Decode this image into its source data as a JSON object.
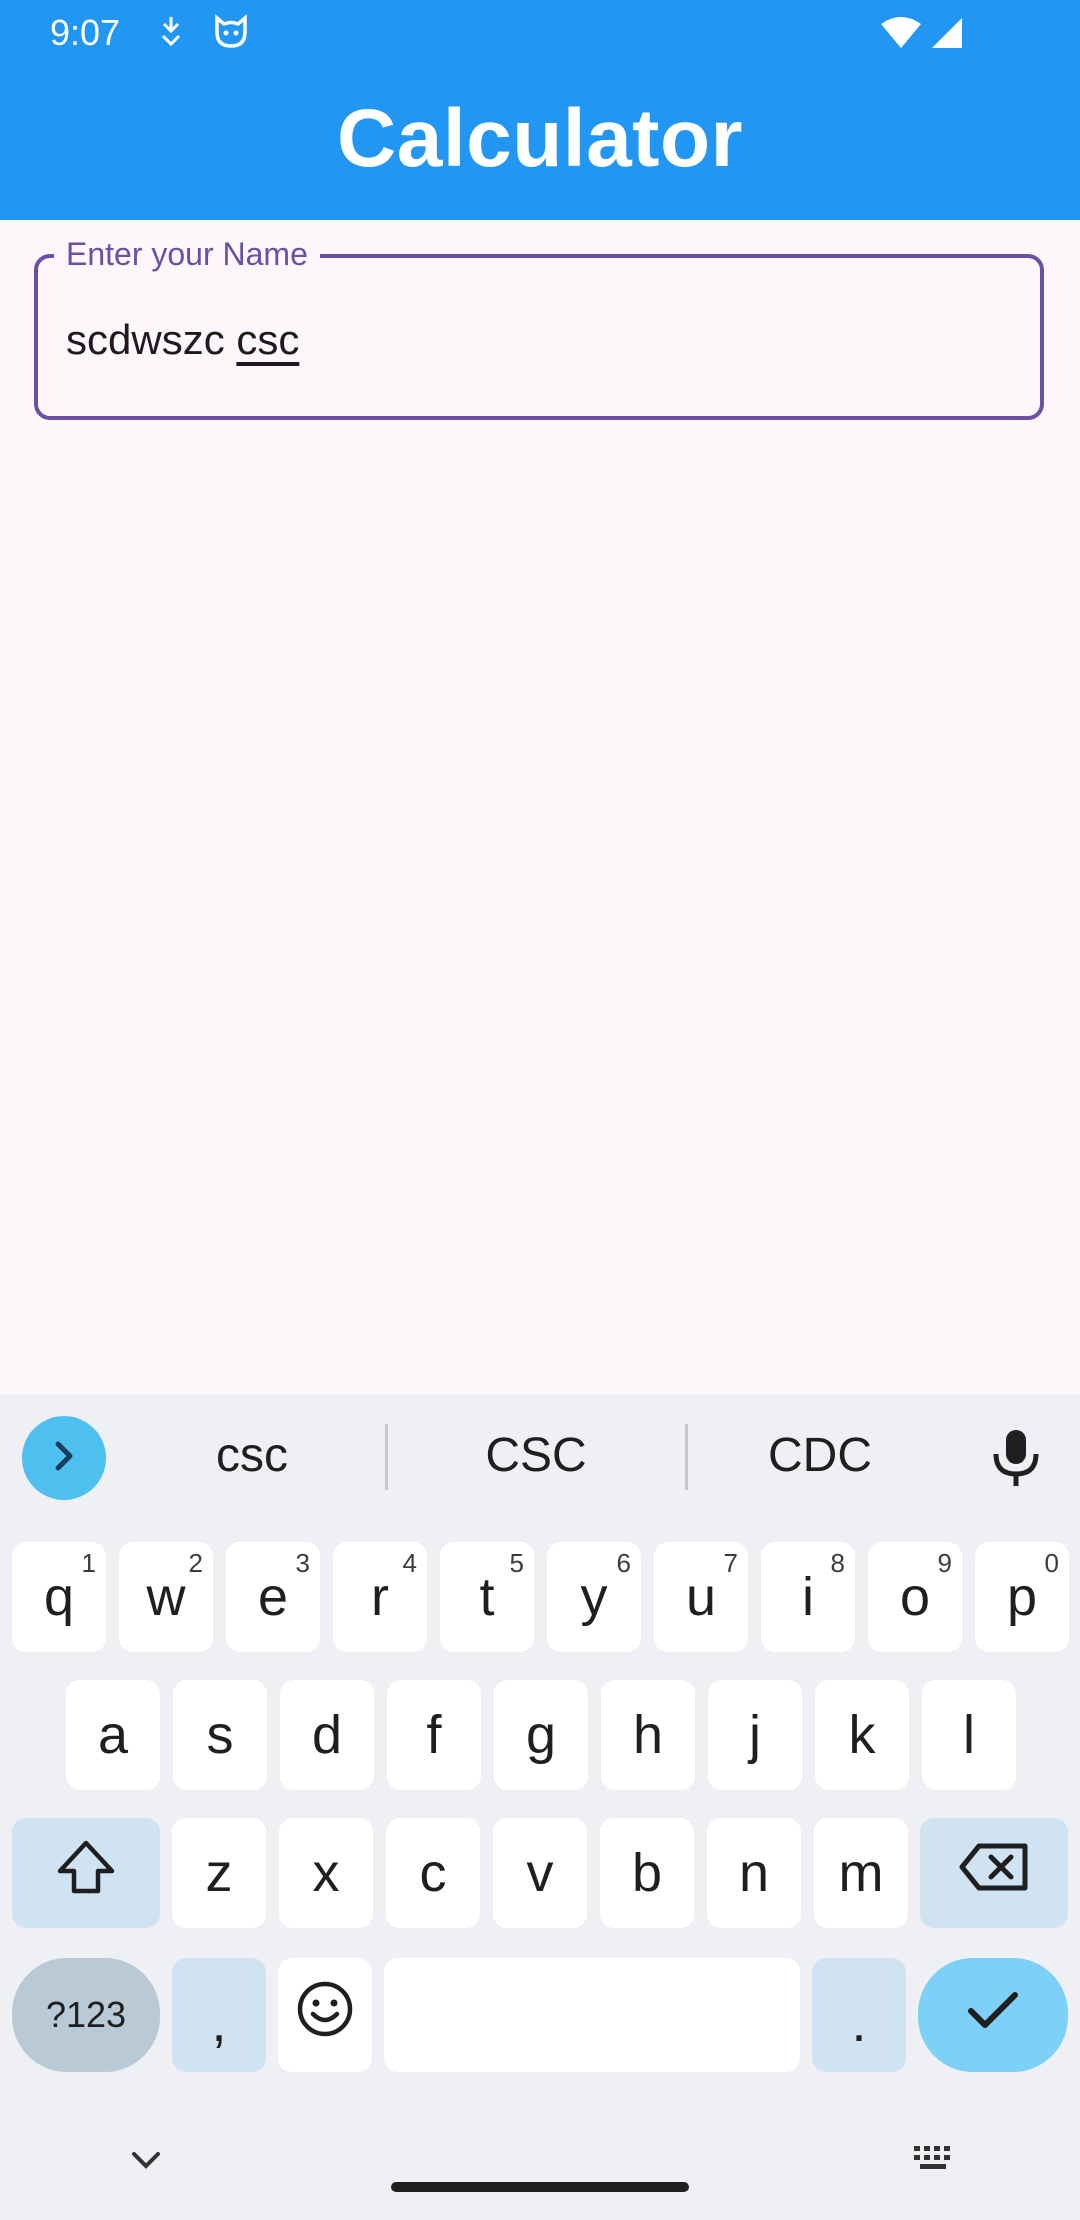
{
  "status_bar": {
    "time": "9:07",
    "icons": [
      "download-notification-icon",
      "cat-app-notification-icon",
      "wifi-icon",
      "cellular-signal-icon"
    ]
  },
  "app_bar": {
    "title": "Calculator",
    "color": "#2196f3"
  },
  "name_field": {
    "label": "Enter your Name",
    "value_prefix": "scdwszc ",
    "value_composing": "csc",
    "accent": "#6a4fa3"
  },
  "keyboard": {
    "suggestions": [
      "csc",
      "CSC",
      "CDC"
    ],
    "row1": [
      {
        "k": "q",
        "h": "1"
      },
      {
        "k": "w",
        "h": "2"
      },
      {
        "k": "e",
        "h": "3"
      },
      {
        "k": "r",
        "h": "4"
      },
      {
        "k": "t",
        "h": "5"
      },
      {
        "k": "y",
        "h": "6"
      },
      {
        "k": "u",
        "h": "7"
      },
      {
        "k": "i",
        "h": "8"
      },
      {
        "k": "o",
        "h": "9"
      },
      {
        "k": "p",
        "h": "0"
      }
    ],
    "row2": [
      "a",
      "s",
      "d",
      "f",
      "g",
      "h",
      "j",
      "k",
      "l"
    ],
    "row3": [
      "z",
      "x",
      "c",
      "v",
      "b",
      "n",
      "m"
    ],
    "symbols_label": "?123",
    "comma": ",",
    "period": ".",
    "icons": [
      "expand-suggestions-icon",
      "microphone-icon",
      "shift-icon",
      "backspace-icon",
      "emoji-icon",
      "enter-check-icon",
      "hide-keyboard-icon",
      "keyboard-switch-icon"
    ]
  }
}
